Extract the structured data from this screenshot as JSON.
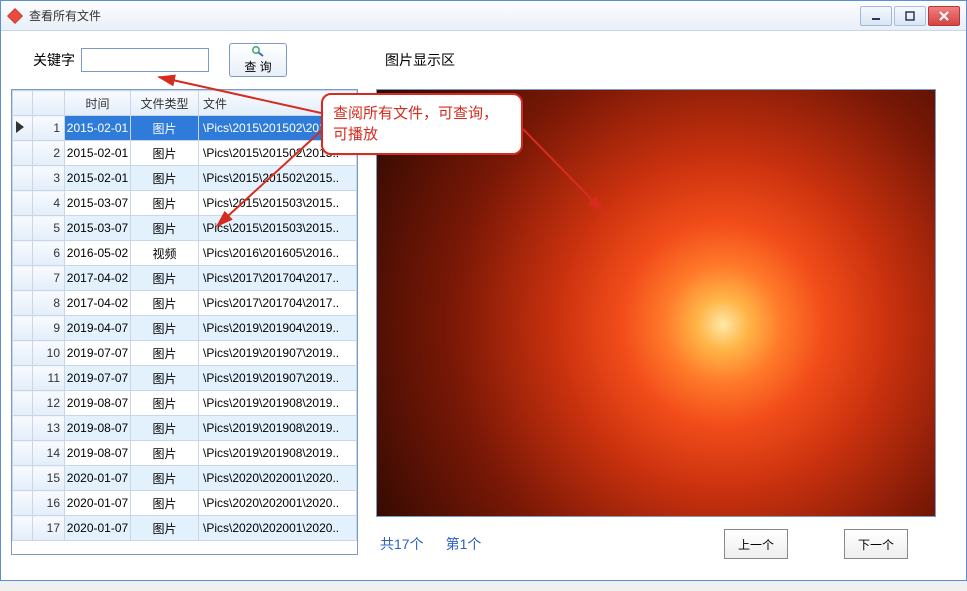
{
  "window": {
    "title": "查看所有文件"
  },
  "search": {
    "keyword_label": "关键字",
    "keyword_value": "",
    "query_label": "查  询"
  },
  "image_area": {
    "label": "图片显示区"
  },
  "columns": {
    "time": "时间",
    "type": "文件类型",
    "file": "文件"
  },
  "rows": [
    {
      "idx": 1,
      "time": "2015-02-01",
      "type": "图片",
      "file": "\\Pics\\2015\\201502\\2015..",
      "selected": true
    },
    {
      "idx": 2,
      "time": "2015-02-01",
      "type": "图片",
      "file": "\\Pics\\2015\\201502\\2015.."
    },
    {
      "idx": 3,
      "time": "2015-02-01",
      "type": "图片",
      "file": "\\Pics\\2015\\201502\\2015.."
    },
    {
      "idx": 4,
      "time": "2015-03-07",
      "type": "图片",
      "file": "\\Pics\\2015\\201503\\2015.."
    },
    {
      "idx": 5,
      "time": "2015-03-07",
      "type": "图片",
      "file": "\\Pics\\2015\\201503\\2015.."
    },
    {
      "idx": 6,
      "time": "2016-05-02",
      "type": "视频",
      "file": "\\Pics\\2016\\201605\\2016.."
    },
    {
      "idx": 7,
      "time": "2017-04-02",
      "type": "图片",
      "file": "\\Pics\\2017\\201704\\2017.."
    },
    {
      "idx": 8,
      "time": "2017-04-02",
      "type": "图片",
      "file": "\\Pics\\2017\\201704\\2017.."
    },
    {
      "idx": 9,
      "time": "2019-04-07",
      "type": "图片",
      "file": "\\Pics\\2019\\201904\\2019.."
    },
    {
      "idx": 10,
      "time": "2019-07-07",
      "type": "图片",
      "file": "\\Pics\\2019\\201907\\2019.."
    },
    {
      "idx": 11,
      "time": "2019-07-07",
      "type": "图片",
      "file": "\\Pics\\2019\\201907\\2019.."
    },
    {
      "idx": 12,
      "time": "2019-08-07",
      "type": "图片",
      "file": "\\Pics\\2019\\201908\\2019.."
    },
    {
      "idx": 13,
      "time": "2019-08-07",
      "type": "图片",
      "file": "\\Pics\\2019\\201908\\2019.."
    },
    {
      "idx": 14,
      "time": "2019-08-07",
      "type": "图片",
      "file": "\\Pics\\2019\\201908\\2019.."
    },
    {
      "idx": 15,
      "time": "2020-01-07",
      "type": "图片",
      "file": "\\Pics\\2020\\202001\\2020.."
    },
    {
      "idx": 16,
      "time": "2020-01-07",
      "type": "图片",
      "file": "\\Pics\\2020\\202001\\2020.."
    },
    {
      "idx": 17,
      "time": "2020-01-07",
      "type": "图片",
      "file": "\\Pics\\2020\\202001\\2020.."
    }
  ],
  "status": {
    "count_text": "共17个",
    "current_text": "第1个"
  },
  "nav": {
    "prev": "上一个",
    "next": "下一个"
  },
  "annotation": {
    "text": "查阅所有文件，可查询，可播放"
  }
}
